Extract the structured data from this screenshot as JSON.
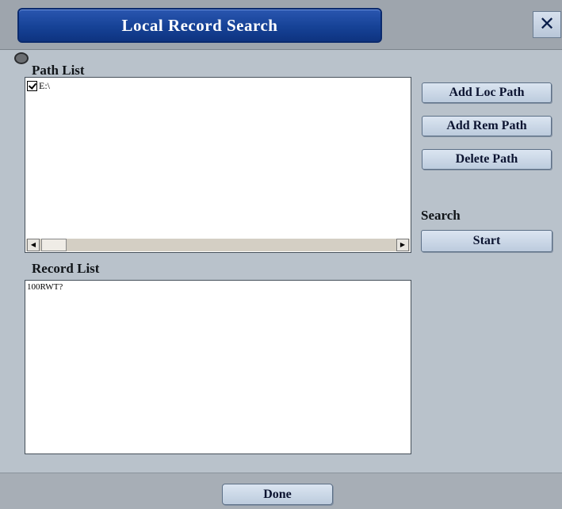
{
  "window": {
    "title": "Local Record Search",
    "close_label": "✕"
  },
  "path_list": {
    "label": "Path List",
    "items": [
      {
        "checked": true,
        "path": "E:\\"
      }
    ]
  },
  "record_list": {
    "label": "Record List",
    "items": [
      "100RWT?"
    ]
  },
  "buttons": {
    "add_loc_path": "Add Loc Path",
    "add_rem_path": "Add Rem Path",
    "delete_path": "Delete Path",
    "start": "Start",
    "done": "Done"
  },
  "search": {
    "label": "Search"
  },
  "scrollbar": {
    "left_arrow": "◀",
    "right_arrow": "▶"
  },
  "colors": {
    "title_bar": "#164296",
    "window_bg": "#b9c2cb",
    "button_bg": "#c9d6e6"
  }
}
